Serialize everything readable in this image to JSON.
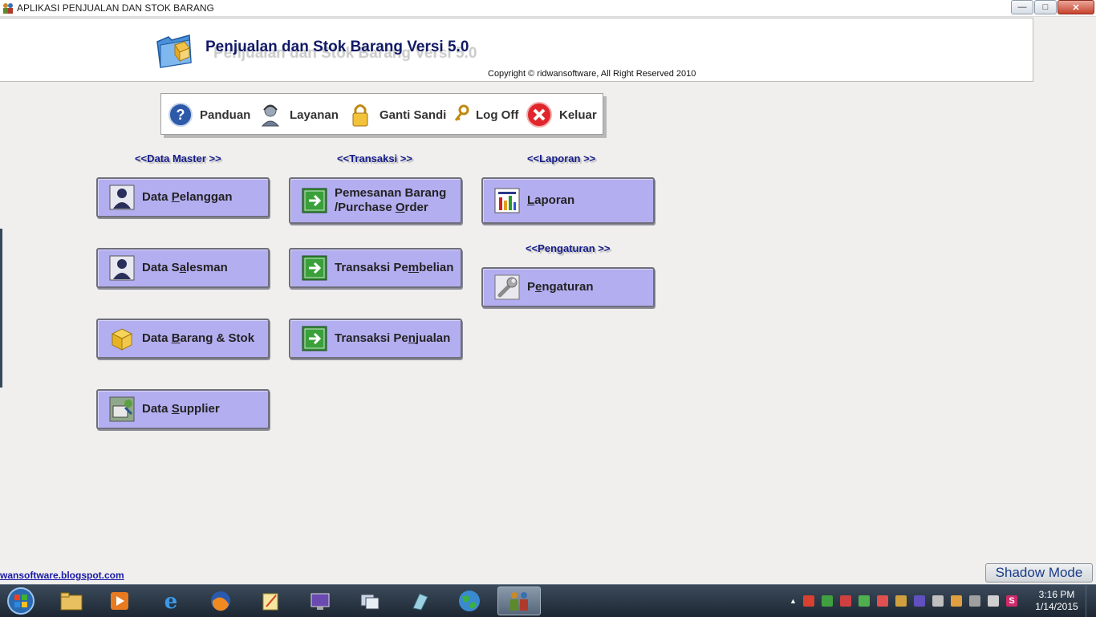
{
  "window": {
    "title": "APLIKASI PENJUALAN DAN STOK BARANG",
    "controls": {
      "minimize": "—",
      "maximize": "□",
      "close": "✕"
    }
  },
  "header": {
    "app_title": "Penjualan dan Stok Barang Versi 5.0",
    "copyright": "Copyright © ridwansoftware, All Right Reserved 2010"
  },
  "toolbar": {
    "items": [
      {
        "label": "Panduan",
        "icon": "help-icon"
      },
      {
        "label": "Layanan",
        "icon": "support-icon"
      },
      {
        "label": "Ganti Sandi",
        "icon": "lock-icon"
      },
      {
        "label": "Log Off",
        "icon": "key-icon"
      },
      {
        "label": "Keluar",
        "icon": "close-icon"
      }
    ]
  },
  "sections": {
    "data_master": "<<Data Master >>",
    "transaksi": "<<Transaksi >>",
    "laporan": "<<Laporan >>",
    "pengaturan": "<<Pengaturan >>"
  },
  "buttons": {
    "data_pelanggan": {
      "pre": "Data ",
      "key": "P",
      "post": "elanggan"
    },
    "data_salesman": {
      "pre": "Data S",
      "key": "a",
      "post": "lesman"
    },
    "data_barang": {
      "pre": "Data ",
      "key": "B",
      "post": "arang & Stok"
    },
    "data_supplier": {
      "pre": "Data ",
      "key": "S",
      "post": "upplier"
    },
    "pemesanan_line1": "Pemesanan Barang",
    "pemesanan_line2": {
      "pre": "/Purchase ",
      "key": "O",
      "post": "rder"
    },
    "pembelian": {
      "pre": "Transaksi Pe",
      "key": "m",
      "post": "belian"
    },
    "penjualan": {
      "pre": "Transaksi Pe",
      "key": "n",
      "post": "jualan"
    },
    "laporan": {
      "pre": "",
      "key": "L",
      "post": "aporan"
    },
    "pengaturan": {
      "pre": "P",
      "key": "e",
      "post": "ngaturan"
    }
  },
  "footer": {
    "blog_link": "wansoftware.blogspot.com",
    "shadow_mode": "Shadow Mode"
  },
  "taskbar": {
    "time": "3:16 PM",
    "date": "1/14/2015"
  }
}
